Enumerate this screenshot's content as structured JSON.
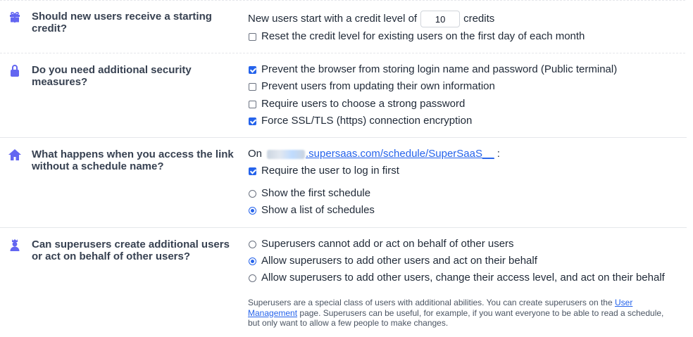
{
  "credits": {
    "question": "Should new users receive a starting credit?",
    "prefix": "New users start with a credit level of",
    "value": "10",
    "suffix": "credits",
    "reset_label": "Reset the credit level for existing users on the first day of each month",
    "reset_checked": false,
    "icon": "gift-icon"
  },
  "security": {
    "question": "Do you need additional security measures?",
    "icon": "lock-icon",
    "options": [
      {
        "label": "Prevent the browser from storing login name and password (Public terminal)",
        "checked": true
      },
      {
        "label": "Prevent users from updating their own information",
        "checked": false
      },
      {
        "label": "Require users to choose a strong password",
        "checked": false
      },
      {
        "label": "Force SSL/TLS (https) connection encryption",
        "checked": true
      }
    ]
  },
  "link": {
    "question": "What happens when you access the link without a schedule name?",
    "icon": "home-icon",
    "on_label": "On",
    "url": ".supersaas.com/schedule/SuperSaaS__",
    "colon": ":",
    "require_login_label": "Require the user to log in first",
    "require_login_checked": true,
    "options": [
      {
        "label": "Show the first schedule",
        "selected": false
      },
      {
        "label": "Show a list of schedules",
        "selected": true
      }
    ]
  },
  "superusers": {
    "question": "Can superusers create additional users or act on behalf of other users?",
    "icon": "superuser-icon",
    "options": [
      {
        "label": "Superusers cannot add or act on behalf of other users",
        "selected": false
      },
      {
        "label": "Allow superusers to add other users and act on their behalf",
        "selected": true
      },
      {
        "label": "Allow superusers to add other users, change their access level, and act on their behalf",
        "selected": false
      }
    ],
    "help_text_1": "Superusers are a special class of users with additional abilities. You can create superusers on the",
    "help_link": "User Management",
    "help_text_2": "page. Superusers can be useful, for example, if you want everyone to be able to read a schedule, but only want to allow a few people to make changes."
  },
  "colors": {
    "accent": "#2563eb",
    "icon": "#6366f1",
    "divider": "#e5e7eb"
  }
}
